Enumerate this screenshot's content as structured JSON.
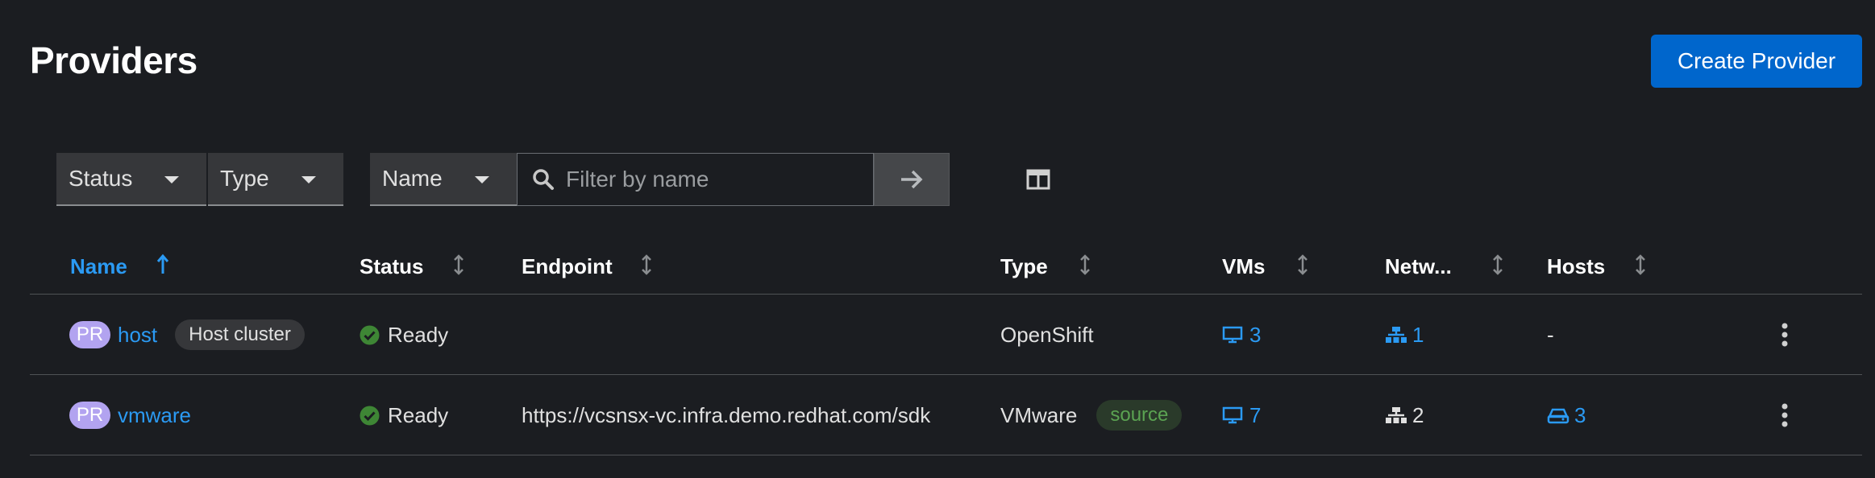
{
  "header": {
    "title": "Providers",
    "create_button": "Create Provider"
  },
  "toolbar": {
    "status_filter": "Status",
    "type_filter": "Type",
    "attribute_select": "Name",
    "search_placeholder": "Filter by name"
  },
  "table": {
    "columns": [
      "Name",
      "Status",
      "Endpoint",
      "Type",
      "VMs",
      "Netw...",
      "Hosts"
    ],
    "sorted_column": "Name",
    "rows": [
      {
        "badge": "PR",
        "name": "host",
        "label": "Host cluster",
        "status": "Ready",
        "endpoint": "",
        "type": "OpenShift",
        "type_label": "",
        "vms": "3",
        "networks": "1",
        "hosts": "-"
      },
      {
        "badge": "PR",
        "name": "vmware",
        "label": "",
        "status": "Ready",
        "endpoint": "https://vcsnsx-vc.infra.demo.redhat.com/sdk",
        "type": "VMware",
        "type_label": "source",
        "vms": "7",
        "networks": "2",
        "hosts": "3"
      }
    ]
  },
  "colors": {
    "background": "#1b1d21",
    "accent": "#0066cc",
    "link": "#2b9af3",
    "success": "#3e8635",
    "badge": "#b2a3f0"
  }
}
